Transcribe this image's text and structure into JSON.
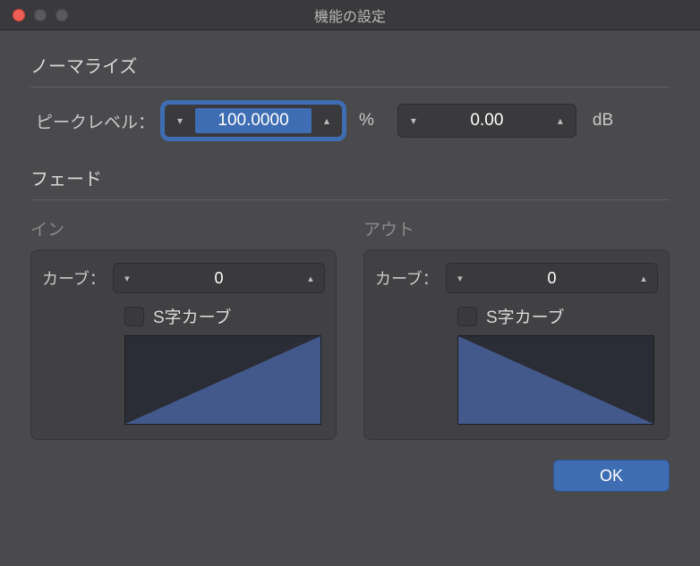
{
  "window": {
    "title": "機能の設定"
  },
  "normalize": {
    "header": "ノーマライズ",
    "peak_label": "ピークレベル：",
    "peak_value": "100.0000",
    "peak_unit": "%",
    "db_value": "0.00",
    "db_unit": "dB"
  },
  "fade": {
    "header": "フェード",
    "in": {
      "label": "イン",
      "curve_label": "カーブ：",
      "curve_value": "0",
      "scurve_label": "S字カーブ",
      "scurve_checked": false
    },
    "out": {
      "label": "アウト",
      "curve_label": "カーブ：",
      "curve_value": "0",
      "scurve_label": "S字カーブ",
      "scurve_checked": false
    }
  },
  "buttons": {
    "ok": "OK"
  },
  "colors": {
    "accent": "#3f6db3",
    "graph_fill": "#44598b"
  }
}
